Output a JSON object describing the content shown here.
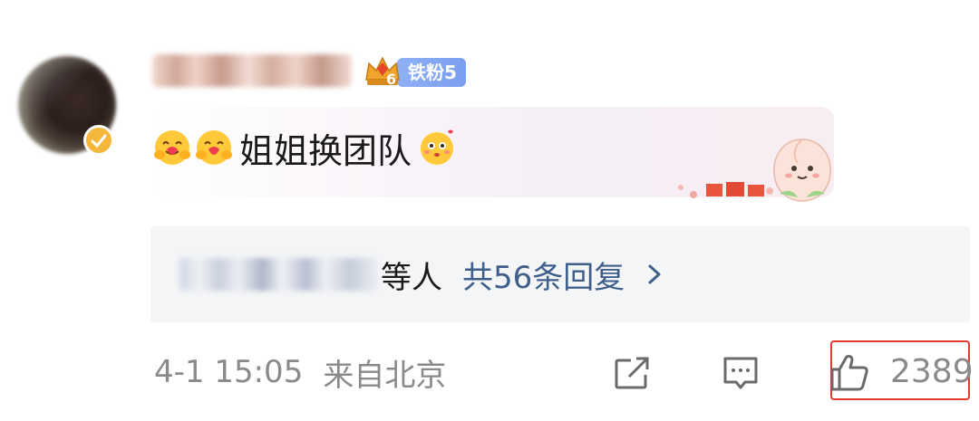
{
  "comment": {
    "username": "",
    "fan_badge": {
      "level": "6",
      "label": "铁粉5",
      "color": "#7b9ff0"
    },
    "text": "姐姐换团队",
    "emojis_before": [
      "hug-emoji",
      "hug-emoji"
    ],
    "emoji_after": "shy-emoji",
    "decoration": "peach-mascot"
  },
  "replies": {
    "names": "",
    "suffix": "等人",
    "count_label": "共56条回复",
    "count_color": "#3f5f8a"
  },
  "footer": {
    "time": "4-1 15:05",
    "location": "来自北京",
    "likes": "2389",
    "highlight_color": "#e23a2e"
  }
}
